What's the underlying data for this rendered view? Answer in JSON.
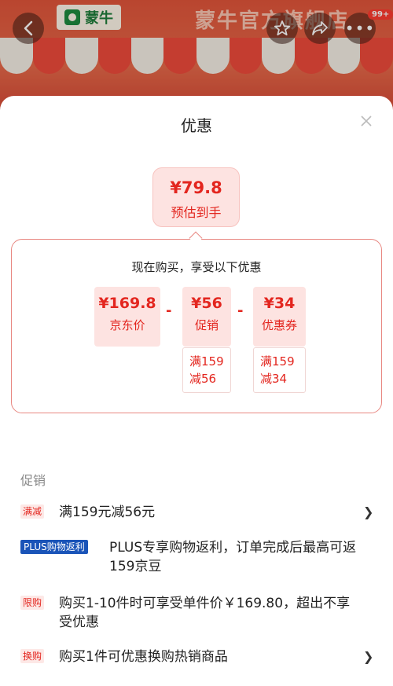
{
  "store": {
    "brand_name": "蒙牛",
    "banner_title": "蒙牛官方旗舰店",
    "notification_badge": "99+"
  },
  "sheet": {
    "title": "优惠",
    "final": {
      "price": "¥79.8",
      "label": "预估到手"
    },
    "detail_heading": "现在购买，享受以下优惠",
    "items": [
      {
        "price": "¥169.8",
        "label": "京东价"
      },
      {
        "price": "¥56",
        "label": "促销",
        "condition_line1": "满159",
        "condition_line2": "减56"
      },
      {
        "price": "¥34",
        "label": "优惠券",
        "condition_line1": "满159",
        "condition_line2": "减34"
      }
    ],
    "operators": [
      "-",
      "-"
    ]
  },
  "promotions": {
    "section_label": "促销",
    "rows": [
      {
        "tag": "满减",
        "text": "满159元减56元",
        "has_arrow": true
      },
      {
        "tag": "PLUS购物返利",
        "text_line1": "PLUS专享购物返利，订单完成后最高可返",
        "text_line2": "159京豆",
        "has_arrow": false
      },
      {
        "tag": "限购",
        "text_line1": "购买1-10件时可享受单件价￥169.80，超出不享",
        "text_line2": "受优惠",
        "has_arrow": false
      },
      {
        "tag": "换购",
        "text": "购买1件可优惠换购热销商品",
        "has_arrow": true
      }
    ]
  },
  "icons": {
    "back": "back-arrow-icon",
    "favorite": "star-icon",
    "share": "share-icon",
    "more": "more-icon",
    "close": "close-icon",
    "chevron": "chevron-right-icon"
  },
  "colors": {
    "accent_red": "#e3261f",
    "light_red": "#fde3e1",
    "plus_blue": "#1a54b8"
  }
}
